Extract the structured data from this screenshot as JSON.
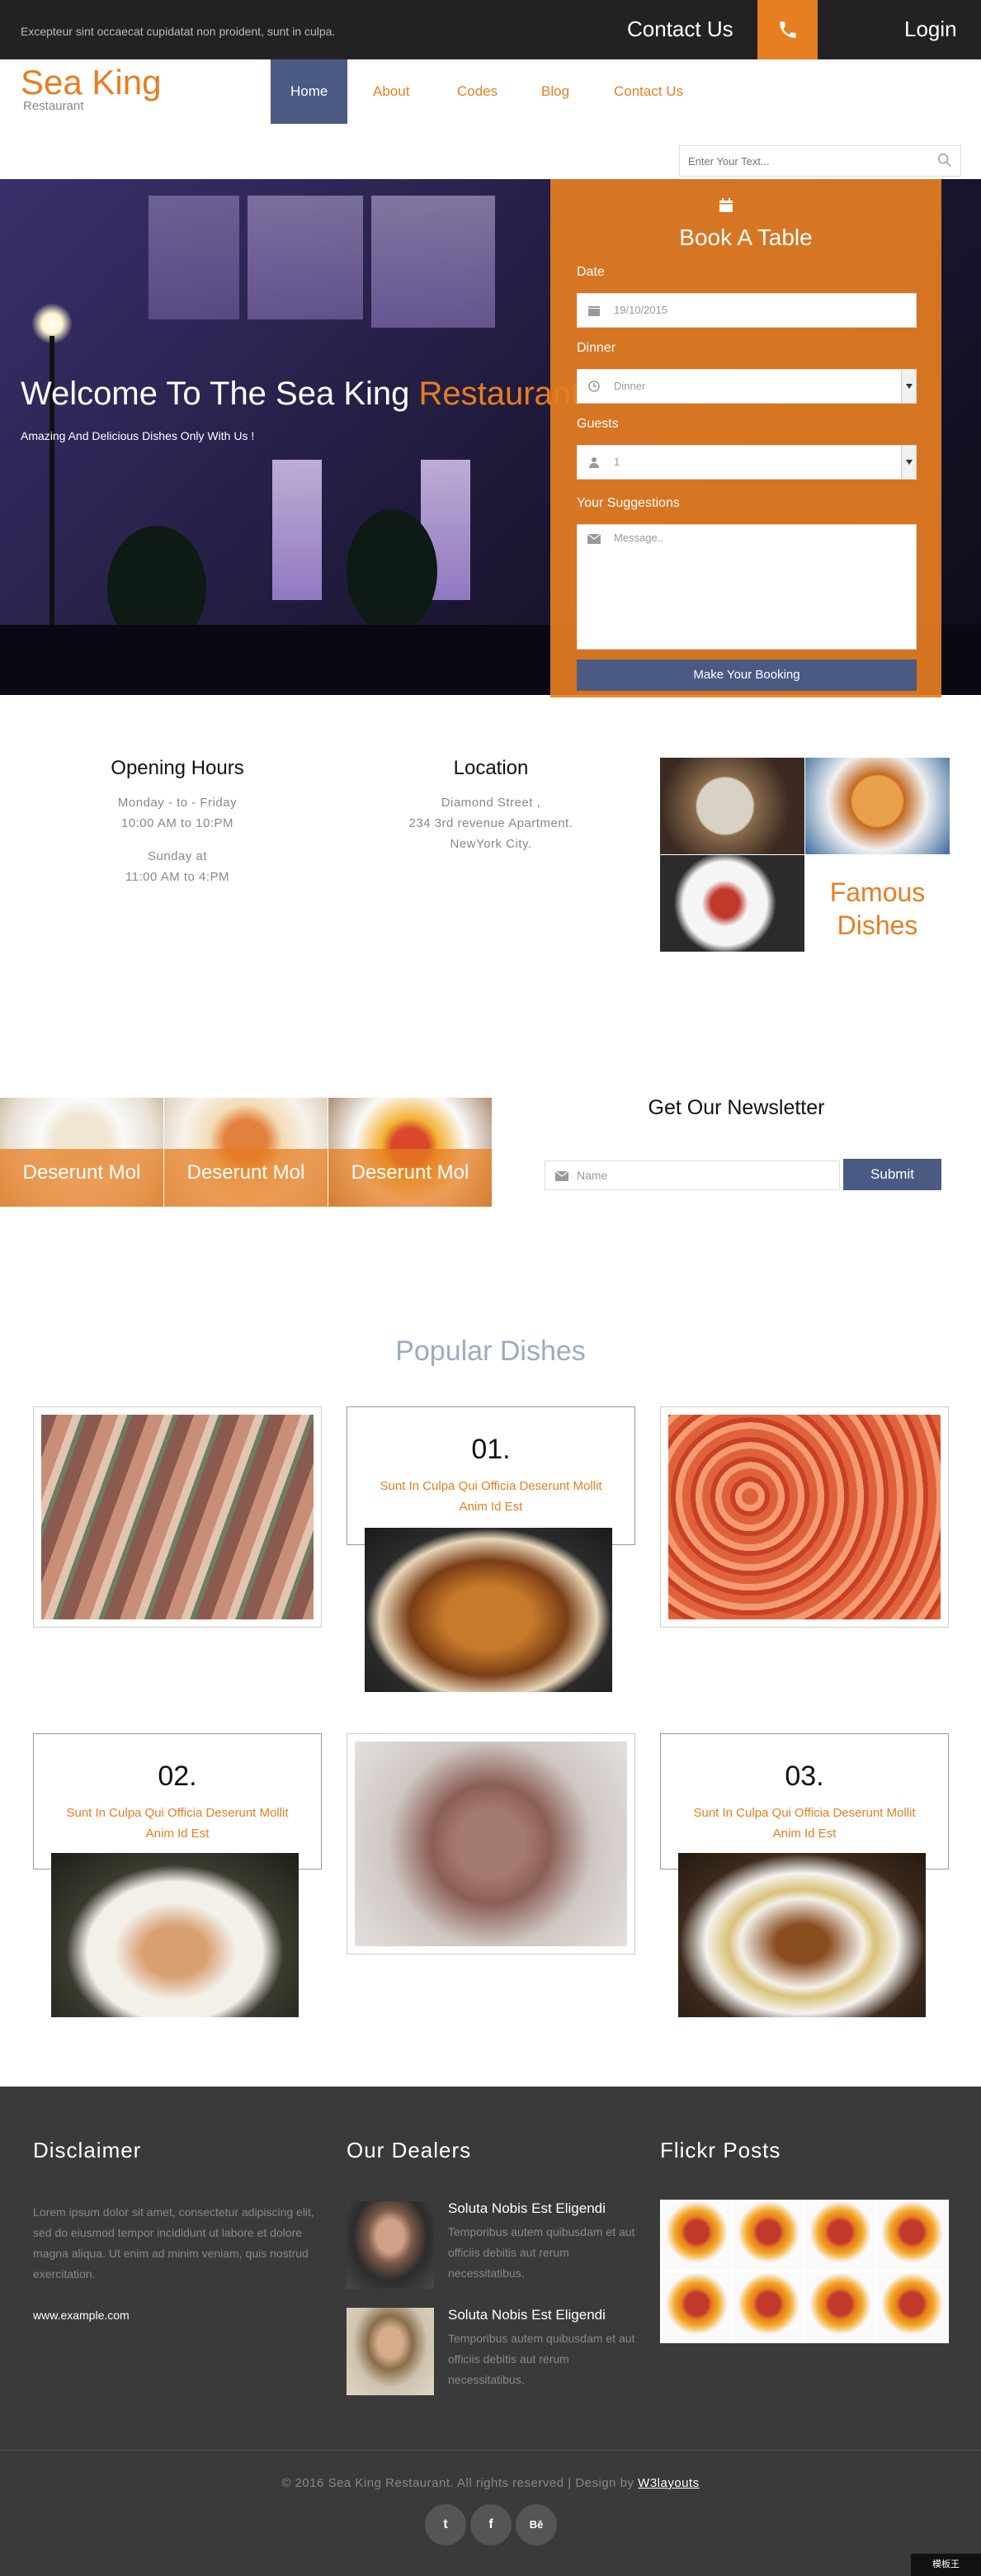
{
  "topbar": {
    "tagline": "Excepteur sint occaecat cupidatat non proident, sunt in culpa.",
    "contact": "Contact Us",
    "phone_icon": "phone-icon",
    "login": "Login"
  },
  "header": {
    "logo": "Sea King",
    "logo_sub": "Restaurant",
    "nav": [
      "Home",
      "About",
      "Codes",
      "Blog",
      "Contact Us"
    ],
    "search_placeholder": "Enter Your Text..."
  },
  "hero": {
    "welcome": "Welcome To The Sea King ",
    "welcome_accent": "Restaurant",
    "subtitle": "Amazing And Delicious Dishes Only With Us !"
  },
  "booking": {
    "title": "Book A Table",
    "date_label": "Date",
    "date_value": "19/10/2015",
    "meal_label": "Dinner",
    "meal_value": "Dinner",
    "guests_label": "Guests",
    "guests_value": "1",
    "suggestions_label": "Your Suggestions",
    "message_placeholder": "Message..",
    "button": "Make Your Booking"
  },
  "info": {
    "hours_title": "Opening Hours",
    "hours_l1": "Monday - to - Friday",
    "hours_l2": "10:00 AM to 10:PM",
    "hours_l3": "Sunday at",
    "hours_l4": "11:00 AM to 4:PM",
    "location_title": "Location",
    "loc_l1": "Diamond Street ,",
    "loc_l2": "234 3rd revenue Apartment.",
    "loc_l3": "NewYork City.",
    "famous_l1": "Famous",
    "famous_l2": "Dishes"
  },
  "newsletter": {
    "captions": [
      "Deserunt Mol",
      "Deserunt Mol",
      "Deserunt Mol"
    ],
    "title": "Get Our Newsletter",
    "input_placeholder": "Name",
    "button": "Submit"
  },
  "popular": {
    "title": "Popular Dishes",
    "cards": [
      {
        "num": "01.",
        "desc": "Sunt In Culpa Qui Officia Deserunt Mollit Anim Id Est"
      },
      {
        "num": "02.",
        "desc": "Sunt In Culpa Qui Officia Deserunt Mollit Anim Id Est"
      },
      {
        "num": "03.",
        "desc": "Sunt In Culpa Qui Officia Deserunt Mollit Anim Id Est"
      }
    ]
  },
  "footer": {
    "disclaimer_title": "Disclaimer",
    "disclaimer_text": "Lorem ipsum dolor sit amet, consectetur adipiscing elit, sed do eiusmod tempor incididunt ut labore et dolore magna aliqua. Ut enim ad minim veniam, quis nostrud exercitation.",
    "disclaimer_link": "www.example.com",
    "dealers_title": "Our Dealers",
    "dealers": [
      {
        "name": "Soluta Nobis Est Eligendi",
        "text": "Temporibus autem quibusdam et aut officiis debitis aut rerum necessitatibus."
      },
      {
        "name": "Soluta Nobis Est Eligendi",
        "text": "Temporibus autem quibusdam et aut officiis debitis aut rerum necessitatibus."
      }
    ],
    "flickr_title": "Flickr Posts",
    "copyright": "© 2016 Sea King Restaurant. All rights reserved | Design by ",
    "copyright_link": "W3layouts",
    "social": [
      "twitter-icon",
      "facebook-icon",
      "behance-icon"
    ],
    "social_glyphs": [
      "t",
      "f",
      "Bē"
    ],
    "corner_badge": "模板王"
  },
  "colors": {
    "accent": "#e67e22",
    "nav_active": "#4a5a82",
    "topbar": "#222222",
    "footer": "#3a3a3a",
    "popular_title": "#9aadbf"
  }
}
